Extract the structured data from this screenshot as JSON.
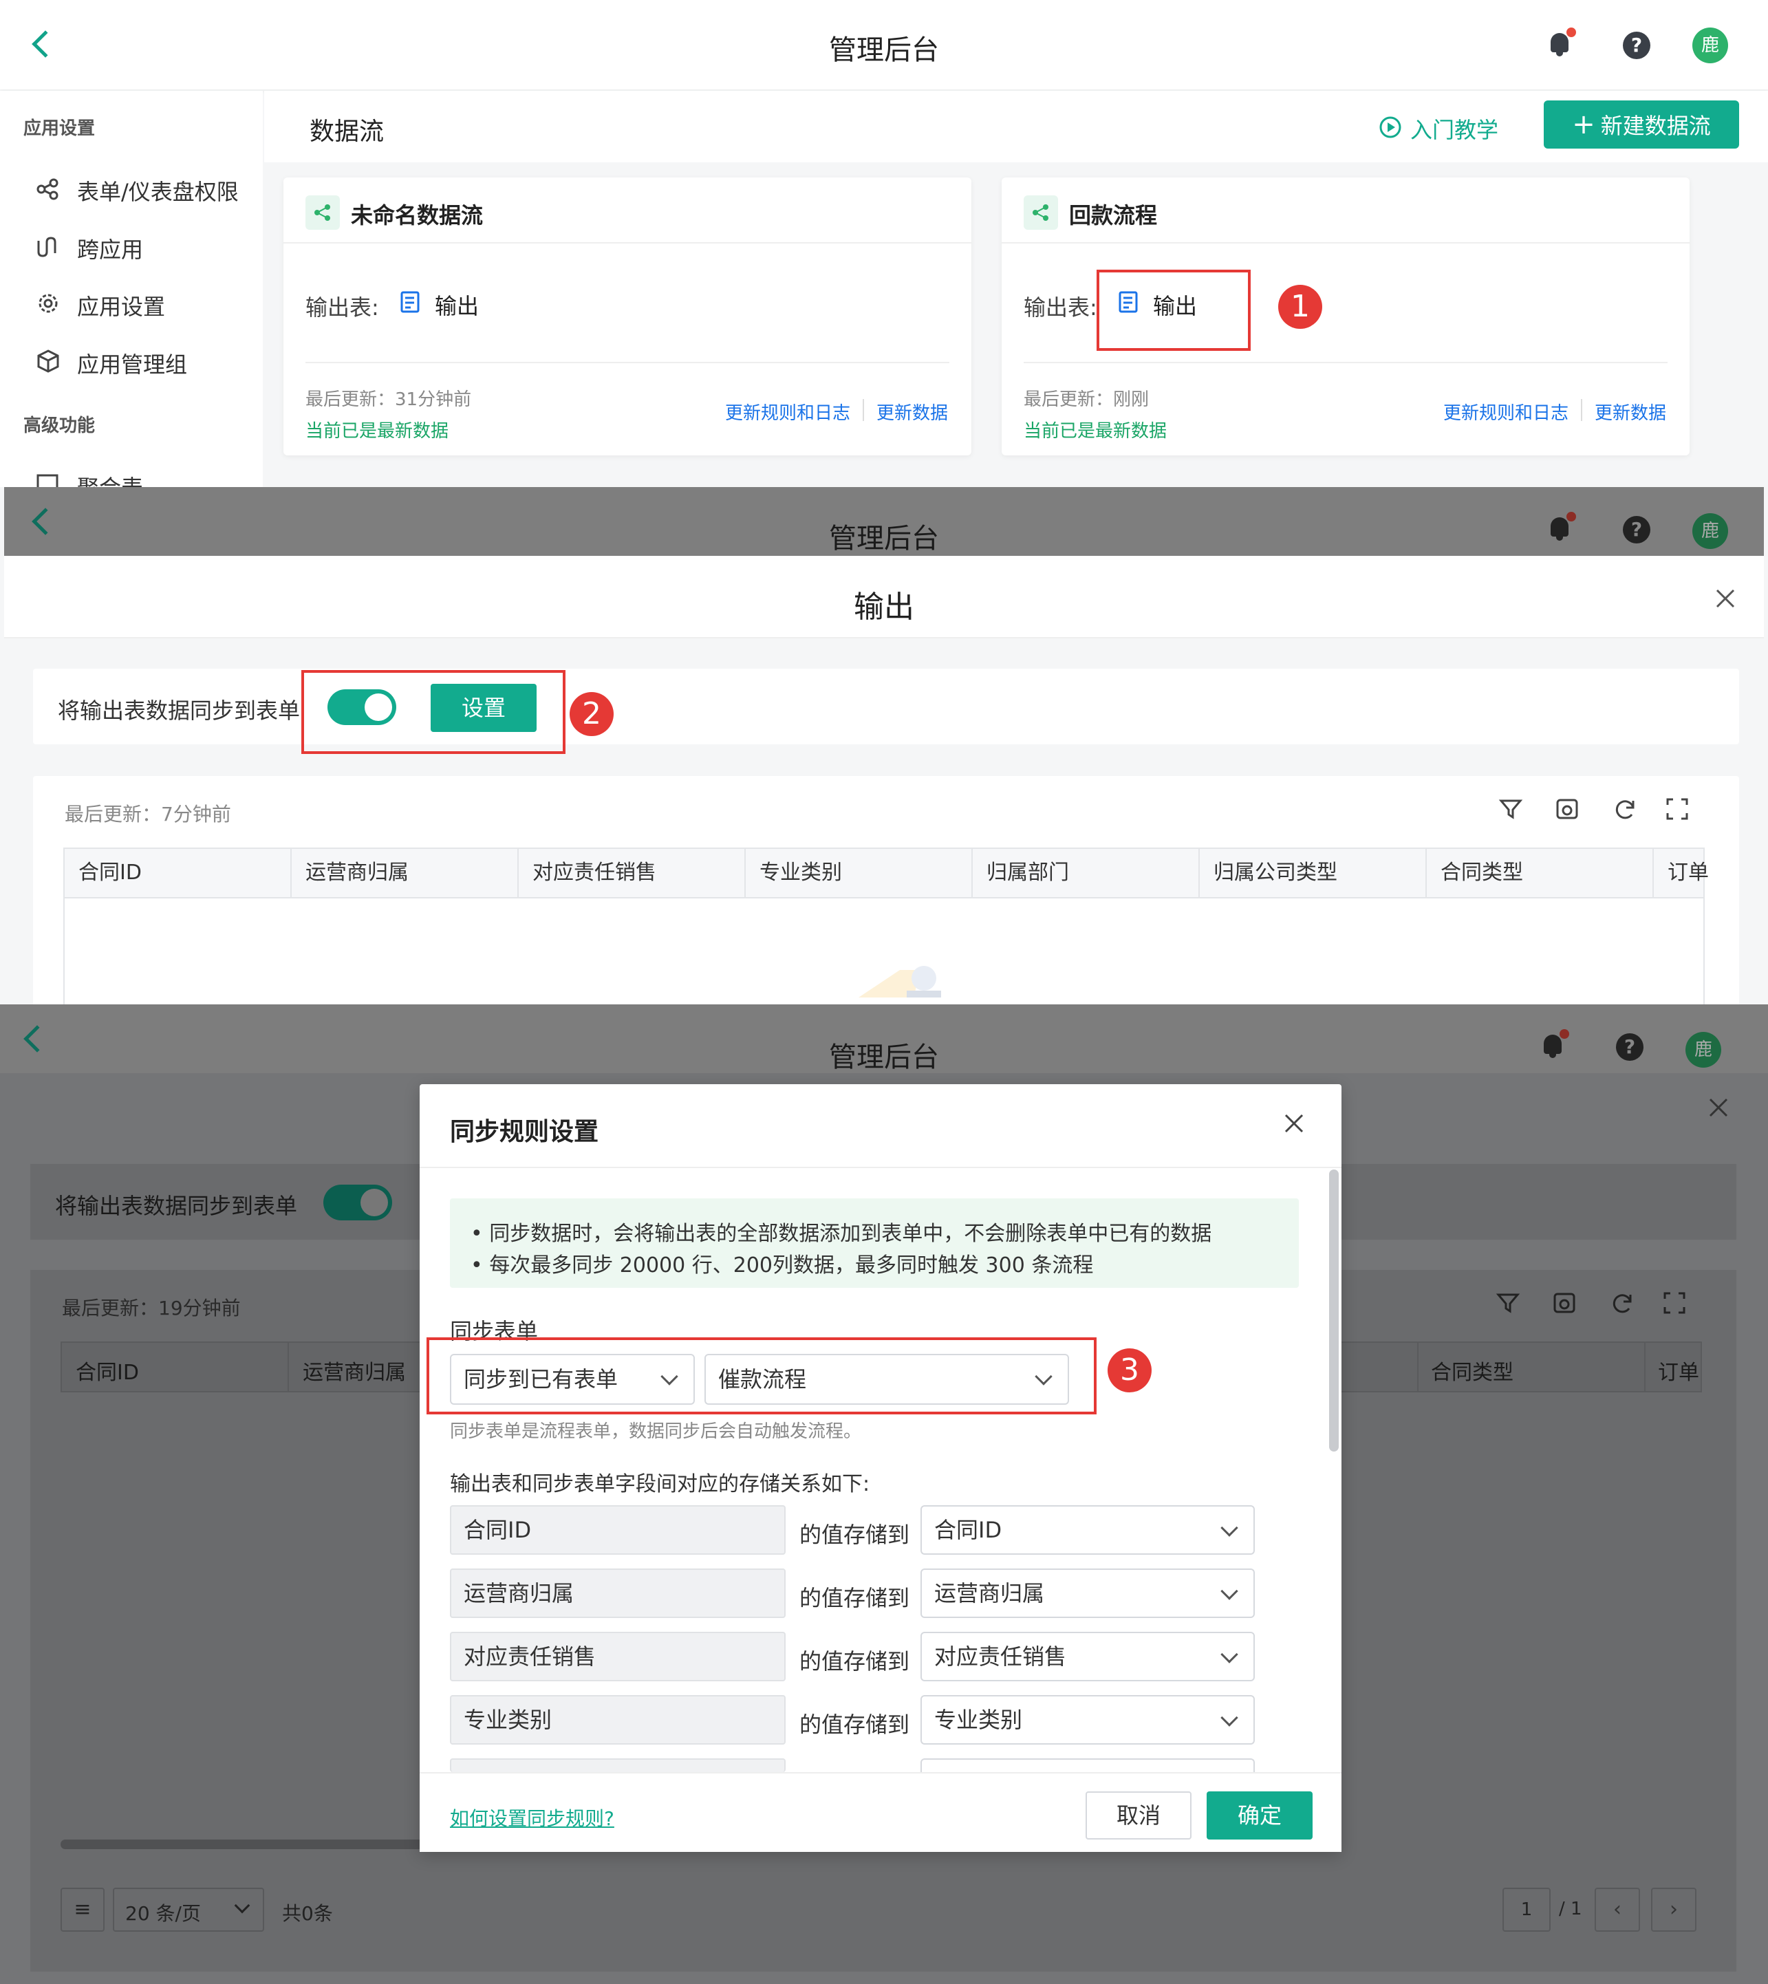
{
  "app_title": "管理后台",
  "avatar_text": "鹿",
  "sidebar": {
    "section1": "应用设置",
    "items": [
      {
        "label": "表单/仪表盘权限",
        "icon": "share-icon"
      },
      {
        "label": "跨应用",
        "icon": "cross-app-icon"
      },
      {
        "label": "应用设置",
        "icon": "gear-icon"
      },
      {
        "label": "应用管理组",
        "icon": "cube-icon"
      }
    ],
    "section2": "高级功能",
    "partial_item": "聚合表"
  },
  "dataflow": {
    "title": "数据流",
    "tutorial": "入门教学",
    "new_button": "新建数据流",
    "cards": [
      {
        "name": "未命名数据流",
        "output_label": "输出表:",
        "output_name": "输出",
        "last_update": "最后更新：31分钟前",
        "status": "当前已是最新数据",
        "rules_link": "更新规则和日志",
        "data_link": "更新数据"
      },
      {
        "name": "回款流程",
        "output_label": "输出表:",
        "output_name": "输出",
        "last_update": "最后更新：刚刚",
        "status": "当前已是最新数据",
        "rules_link": "更新规则和日志",
        "data_link": "更新数据"
      }
    ]
  },
  "output_panel": {
    "title": "输出",
    "sync_label": "将输出表数据同步到表单",
    "toggle_on": true,
    "settings_button": "设置",
    "last_update": "最后更新：7分钟前",
    "columns": [
      "合同ID",
      "运营商归属",
      "对应责任销售",
      "专业类别",
      "归属部门",
      "归属公司类型",
      "合同类型",
      "订单"
    ]
  },
  "dialog_panel": {
    "bg_sync_label": "将输出表数据同步到表单",
    "bg_last_update": "最后更新：19分钟前",
    "bg_columns_left": [
      "合同ID",
      "运营商归属"
    ],
    "bg_columns_right": [
      "合同类型",
      "订单"
    ],
    "pagination": {
      "page_size": "20 条/页",
      "total": "共0条",
      "page": "1",
      "pages": "/ 1"
    },
    "dialog": {
      "title": "同步规则设置",
      "notes": [
        "• 同步数据时，会将输出表的全部数据添加到表单中，不会删除表单中已有的数据",
        "• 每次最多同步 20000 行、200列数据，最多同时触发 300 条流程"
      ],
      "sync_form_label": "同步表单",
      "mode": "同步到已有表单",
      "target_form": "催款流程",
      "hint": "同步表单是流程表单，数据同步后会自动触发流程。",
      "mapping_label": "输出表和同步表单字段间对应的存储关系如下:",
      "store_to": "的值存储到",
      "mappings": [
        {
          "source": "合同ID",
          "target": "合同ID"
        },
        {
          "source": "运营商归属",
          "target": "运营商归属"
        },
        {
          "source": "对应责任销售",
          "target": "对应责任销售"
        },
        {
          "source": "专业类别",
          "target": "专业类别"
        }
      ],
      "help_link": "如何设置同步规则?",
      "cancel": "取消",
      "ok": "确定"
    }
  },
  "callouts": [
    "1",
    "2",
    "3"
  ],
  "colors": {
    "accent": "#12ab8e",
    "link": "#1a73e8",
    "success": "#1aa566",
    "highlight": "#e53935"
  }
}
